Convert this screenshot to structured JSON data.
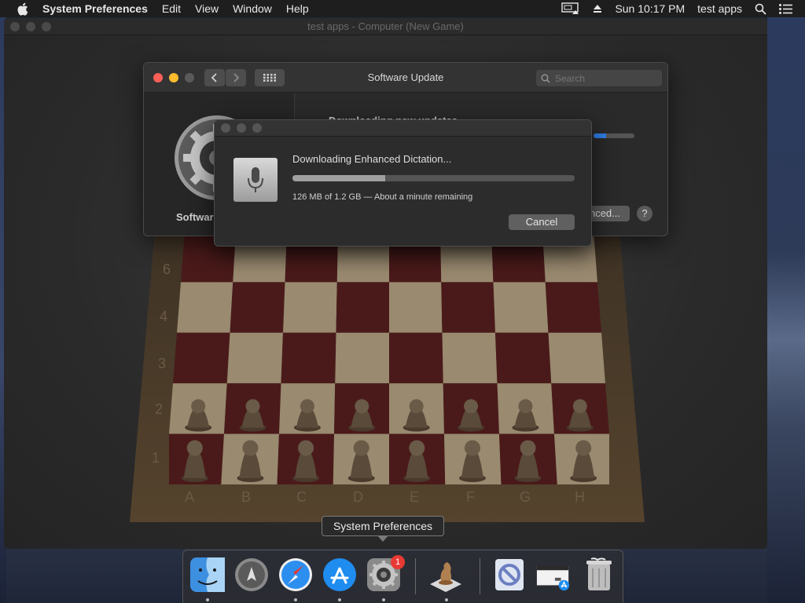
{
  "menubar": {
    "app_name": "System Preferences",
    "menus": [
      "Edit",
      "View",
      "Window",
      "Help"
    ],
    "clock": "Sun 10:17 PM",
    "user": "test apps"
  },
  "chess_window": {
    "title": "test apps - Computer   (New Game)",
    "ranks": [
      "6",
      "4",
      "3",
      "2",
      "1"
    ],
    "files": [
      "A",
      "B",
      "C",
      "D",
      "E",
      "F",
      "G",
      "H"
    ]
  },
  "software_update": {
    "title": "Software Update",
    "search_placeholder": "Search",
    "sidebar_label": "Software",
    "main_text": "Downloading new updates",
    "advanced_label": "nced...",
    "help_label": "?"
  },
  "dictation_dialog": {
    "heading": "Downloading Enhanced Dictation...",
    "status": "126 MB of 1.2 GB — About a minute remaining",
    "progress_fraction": 0.33,
    "cancel_label": "Cancel"
  },
  "tooltip": {
    "text": "System Preferences"
  },
  "dock": {
    "badge_count": "1",
    "items": [
      "finder-icon",
      "launchpad-icon",
      "safari-icon",
      "app-store-icon",
      "system-preferences-icon",
      "chess-icon",
      "preview-icon",
      "downloads-icon",
      "trash-icon"
    ]
  },
  "colors": {
    "accent_blue": "#2f7fe8",
    "badge_red": "#e83a35",
    "close_red": "#fe5f57",
    "minimize_yellow": "#febc2e",
    "board_dark": "#4a1a1a",
    "board_light": "#9a8a70"
  }
}
